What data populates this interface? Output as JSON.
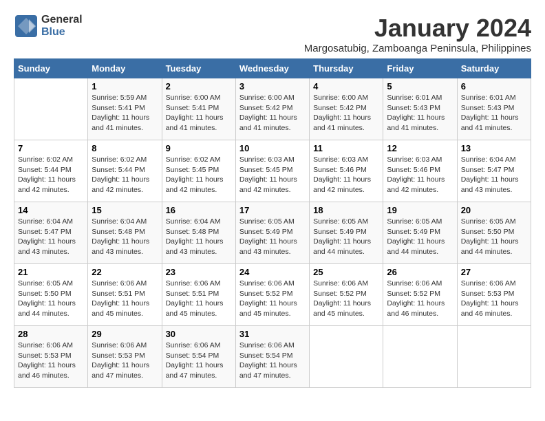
{
  "header": {
    "logo_line1": "General",
    "logo_line2": "Blue",
    "month": "January 2024",
    "location": "Margosatubig, Zamboanga Peninsula, Philippines"
  },
  "days_of_week": [
    "Sunday",
    "Monday",
    "Tuesday",
    "Wednesday",
    "Thursday",
    "Friday",
    "Saturday"
  ],
  "weeks": [
    [
      {
        "day": "",
        "content": ""
      },
      {
        "day": "1",
        "content": "Sunrise: 5:59 AM\nSunset: 5:41 PM\nDaylight: 11 hours\nand 41 minutes."
      },
      {
        "day": "2",
        "content": "Sunrise: 6:00 AM\nSunset: 5:41 PM\nDaylight: 11 hours\nand 41 minutes."
      },
      {
        "day": "3",
        "content": "Sunrise: 6:00 AM\nSunset: 5:42 PM\nDaylight: 11 hours\nand 41 minutes."
      },
      {
        "day": "4",
        "content": "Sunrise: 6:00 AM\nSunset: 5:42 PM\nDaylight: 11 hours\nand 41 minutes."
      },
      {
        "day": "5",
        "content": "Sunrise: 6:01 AM\nSunset: 5:43 PM\nDaylight: 11 hours\nand 41 minutes."
      },
      {
        "day": "6",
        "content": "Sunrise: 6:01 AM\nSunset: 5:43 PM\nDaylight: 11 hours\nand 41 minutes."
      }
    ],
    [
      {
        "day": "7",
        "content": "Sunrise: 6:02 AM\nSunset: 5:44 PM\nDaylight: 11 hours\nand 42 minutes."
      },
      {
        "day": "8",
        "content": "Sunrise: 6:02 AM\nSunset: 5:44 PM\nDaylight: 11 hours\nand 42 minutes."
      },
      {
        "day": "9",
        "content": "Sunrise: 6:02 AM\nSunset: 5:45 PM\nDaylight: 11 hours\nand 42 minutes."
      },
      {
        "day": "10",
        "content": "Sunrise: 6:03 AM\nSunset: 5:45 PM\nDaylight: 11 hours\nand 42 minutes."
      },
      {
        "day": "11",
        "content": "Sunrise: 6:03 AM\nSunset: 5:46 PM\nDaylight: 11 hours\nand 42 minutes."
      },
      {
        "day": "12",
        "content": "Sunrise: 6:03 AM\nSunset: 5:46 PM\nDaylight: 11 hours\nand 42 minutes."
      },
      {
        "day": "13",
        "content": "Sunrise: 6:04 AM\nSunset: 5:47 PM\nDaylight: 11 hours\nand 43 minutes."
      }
    ],
    [
      {
        "day": "14",
        "content": "Sunrise: 6:04 AM\nSunset: 5:47 PM\nDaylight: 11 hours\nand 43 minutes."
      },
      {
        "day": "15",
        "content": "Sunrise: 6:04 AM\nSunset: 5:48 PM\nDaylight: 11 hours\nand 43 minutes."
      },
      {
        "day": "16",
        "content": "Sunrise: 6:04 AM\nSunset: 5:48 PM\nDaylight: 11 hours\nand 43 minutes."
      },
      {
        "day": "17",
        "content": "Sunrise: 6:05 AM\nSunset: 5:49 PM\nDaylight: 11 hours\nand 43 minutes."
      },
      {
        "day": "18",
        "content": "Sunrise: 6:05 AM\nSunset: 5:49 PM\nDaylight: 11 hours\nand 44 minutes."
      },
      {
        "day": "19",
        "content": "Sunrise: 6:05 AM\nSunset: 5:49 PM\nDaylight: 11 hours\nand 44 minutes."
      },
      {
        "day": "20",
        "content": "Sunrise: 6:05 AM\nSunset: 5:50 PM\nDaylight: 11 hours\nand 44 minutes."
      }
    ],
    [
      {
        "day": "21",
        "content": "Sunrise: 6:05 AM\nSunset: 5:50 PM\nDaylight: 11 hours\nand 44 minutes."
      },
      {
        "day": "22",
        "content": "Sunrise: 6:06 AM\nSunset: 5:51 PM\nDaylight: 11 hours\nand 45 minutes."
      },
      {
        "day": "23",
        "content": "Sunrise: 6:06 AM\nSunset: 5:51 PM\nDaylight: 11 hours\nand 45 minutes."
      },
      {
        "day": "24",
        "content": "Sunrise: 6:06 AM\nSunset: 5:52 PM\nDaylight: 11 hours\nand 45 minutes."
      },
      {
        "day": "25",
        "content": "Sunrise: 6:06 AM\nSunset: 5:52 PM\nDaylight: 11 hours\nand 45 minutes."
      },
      {
        "day": "26",
        "content": "Sunrise: 6:06 AM\nSunset: 5:52 PM\nDaylight: 11 hours\nand 46 minutes."
      },
      {
        "day": "27",
        "content": "Sunrise: 6:06 AM\nSunset: 5:53 PM\nDaylight: 11 hours\nand 46 minutes."
      }
    ],
    [
      {
        "day": "28",
        "content": "Sunrise: 6:06 AM\nSunset: 5:53 PM\nDaylight: 11 hours\nand 46 minutes."
      },
      {
        "day": "29",
        "content": "Sunrise: 6:06 AM\nSunset: 5:53 PM\nDaylight: 11 hours\nand 47 minutes."
      },
      {
        "day": "30",
        "content": "Sunrise: 6:06 AM\nSunset: 5:54 PM\nDaylight: 11 hours\nand 47 minutes."
      },
      {
        "day": "31",
        "content": "Sunrise: 6:06 AM\nSunset: 5:54 PM\nDaylight: 11 hours\nand 47 minutes."
      },
      {
        "day": "",
        "content": ""
      },
      {
        "day": "",
        "content": ""
      },
      {
        "day": "",
        "content": ""
      }
    ]
  ]
}
